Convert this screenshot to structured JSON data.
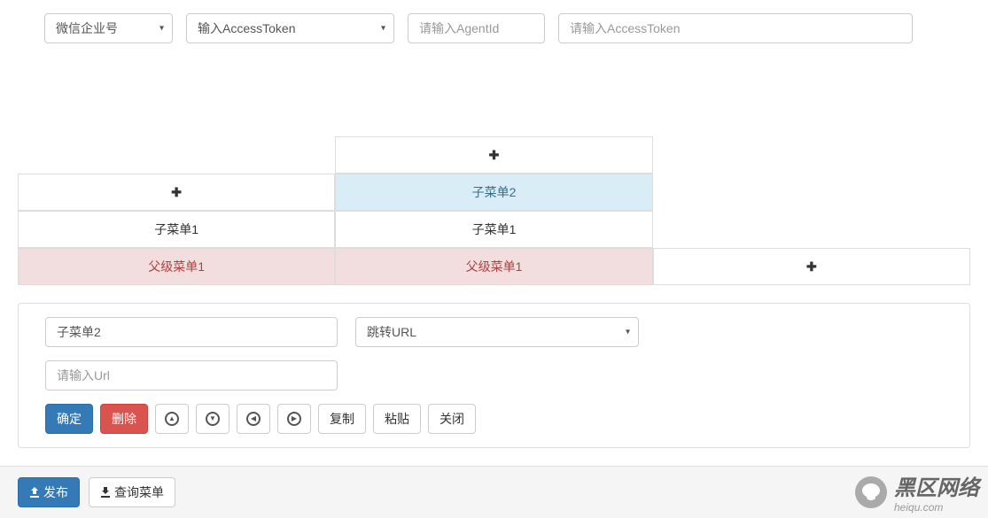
{
  "toolbar": {
    "platform_select": "微信企业号",
    "token_select": "输入AccessToken",
    "agent_placeholder": "请输入AgentId",
    "token_placeholder": "请输入AccessToken"
  },
  "menu": {
    "col1_add": "✚",
    "col1_sub1": "子菜单1",
    "col1_parent": "父级菜单1",
    "col2_add": "✚",
    "col2_sub2": "子菜单2",
    "col2_sub1": "子菜单1",
    "col2_parent": "父级菜单1",
    "col3_add": "✚"
  },
  "form": {
    "name_value": "子菜单2",
    "type_select": "跳转URL",
    "url_placeholder": "请输入Url",
    "confirm": "确定",
    "delete": "删除",
    "copy": "复制",
    "paste": "粘贴",
    "close": "关闭"
  },
  "footer": {
    "publish": "发布",
    "query": "查询菜单"
  },
  "watermark": {
    "cn": "黑区网络",
    "en": "heiqu.com"
  }
}
